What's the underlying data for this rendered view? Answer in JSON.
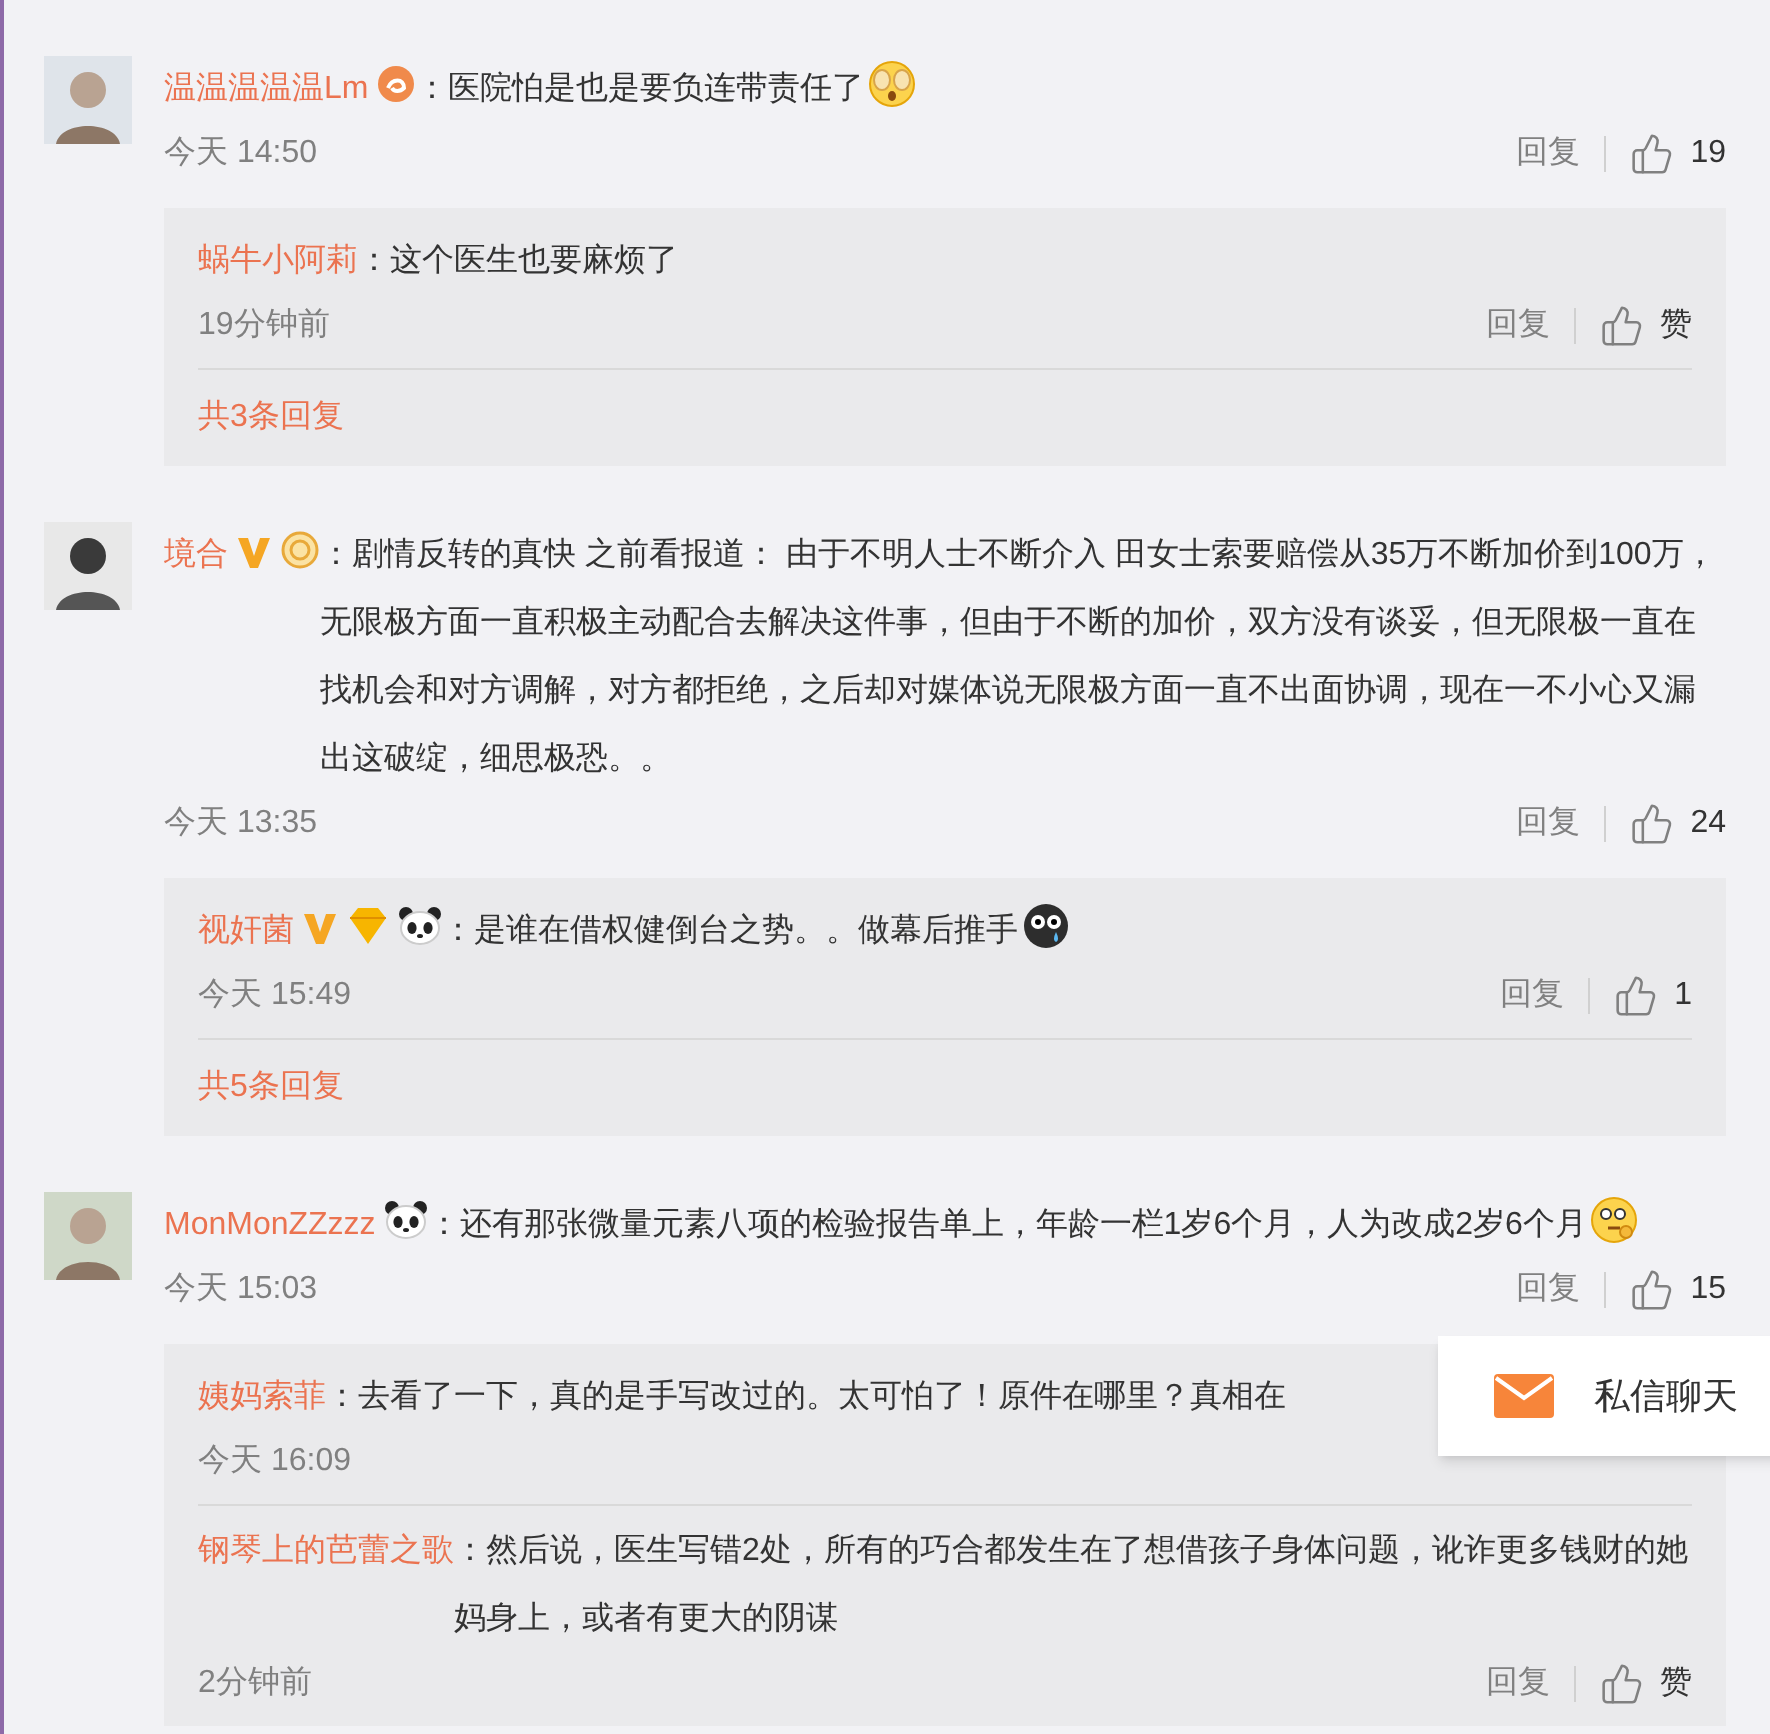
{
  "comments": [
    {
      "user": "温温温温温Lm",
      "badges": [
        {
          "kind": "level"
        }
      ],
      "text": "：医院怕是也是要负连带责任了",
      "emoji": [
        {
          "kind": "covering"
        }
      ],
      "time": "今天 14:50",
      "reply_label": "回复",
      "likes": "19",
      "thread": {
        "replies": [
          {
            "user": "蜗牛小阿莉",
            "text": "：这个医生也要麻烦了",
            "time": "19分钟前",
            "reply_label": "回复",
            "likes": "赞"
          }
        ],
        "more": "共3条回复"
      }
    },
    {
      "user": "境合",
      "badges": [
        {
          "kind": "verified"
        },
        {
          "kind": "medal"
        }
      ],
      "text": "：剧情反转的真快 之前看报道： 由于不明人士不断介入 田女士索要赔偿从35万不断加价到100万，无限极方面一直积极主动配合去解决这件事，但由于不断的加价，双方没有谈妥，但无限极一直在找机会和对方调解，对方都拒绝，之后却对媒体说无限极方面一直不出面协调，现在一不小心又漏出这破绽，细思极恐。。",
      "time": "今天 13:35",
      "reply_label": "回复",
      "likes": "24",
      "thread": {
        "replies": [
          {
            "user": "视奸菌",
            "badges": [
              {
                "kind": "verified"
              },
              {
                "kind": "vip"
              },
              {
                "kind": "panda"
              }
            ],
            "text": "：是谁在借权健倒台之势。。做幕后推手",
            "emoji": [
              {
                "kind": "crying"
              }
            ],
            "time": "今天 15:49",
            "reply_label": "回复",
            "likes": "1"
          }
        ],
        "more": "共5条回复"
      }
    },
    {
      "user": "MonMonZZzzz",
      "badges": [
        {
          "kind": "panda"
        }
      ],
      "text": "：还有那张微量元素八项的检验报告单上，年龄一栏1岁6个月，人为改成2岁6个月",
      "emoji": [
        {
          "kind": "thinking"
        }
      ],
      "time": "今天 15:03",
      "reply_label": "回复",
      "likes": "15",
      "thread": {
        "replies": [
          {
            "user": "姨妈索菲",
            "text": "：去看了一下，真的是手写改过的。太可怕了！原件在哪里？真相在",
            "time": "今天 16:09"
          },
          {
            "user": "钢琴上的芭蕾之歌",
            "text": "：然后说，医生写错2处，所有的巧合都发生在了想借孩子身体问题，讹诈更多钱财的她妈身上，或者有更大的阴谋",
            "time": "2分钟前",
            "reply_label": "回复",
            "likes": "赞"
          }
        ]
      }
    }
  ],
  "chat_button": {
    "label": "私信聊天"
  }
}
